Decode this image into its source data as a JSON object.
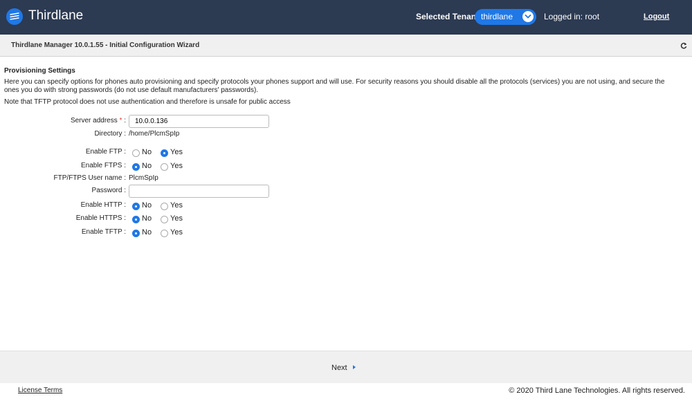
{
  "header": {
    "app_title": "Thirdlane",
    "tenant_label": "Selected Tenant :",
    "tenant_value": "thirdlane",
    "logged_in": "Logged in: root",
    "logout": "Logout"
  },
  "titlebar": {
    "title": "Thirdlane Manager 10.0.1.55 - Initial Configuration Wizard"
  },
  "provisioning": {
    "title": "Provisioning Settings",
    "description": "Here you can specify options for phones auto provisioning and specify protocols your phones support and will use. For security reasons you should disable all the protocols (services) you are not using, and secure the ones you do with strong passwords (do not use default manufacturers' passwords).",
    "note": "Note that TFTP protocol does not use authentication and therefore is unsafe for public access",
    "server_address": {
      "label": "Server address",
      "required_mark": "*",
      "colon": ":",
      "value": "10.0.0.136"
    },
    "directory": {
      "label": "Directory :",
      "value": "/home/PlcmSpIp"
    },
    "enable_ftp": {
      "label": "Enable FTP :",
      "no": "No",
      "yes": "Yes",
      "selected": "Yes"
    },
    "enable_ftps": {
      "label": "Enable FTPS :",
      "no": "No",
      "yes": "Yes",
      "selected": "No"
    },
    "ftp_user": {
      "label": "FTP/FTPS User name :",
      "value": "PlcmSpIp"
    },
    "password": {
      "label": "Password :",
      "value": ""
    },
    "enable_http": {
      "label": "Enable HTTP :",
      "no": "No",
      "yes": "Yes",
      "selected": "No"
    },
    "enable_https": {
      "label": "Enable HTTPS :",
      "no": "No",
      "yes": "Yes",
      "selected": "No"
    },
    "enable_tftp": {
      "label": "Enable TFTP :",
      "no": "No",
      "yes": "Yes",
      "selected": "No"
    }
  },
  "nav": {
    "next": "Next"
  },
  "footer": {
    "license": "License Terms",
    "copyright": "© 2020 Third Lane Technologies. All rights reserved."
  },
  "colors": {
    "header_bg": "#2c3a52",
    "accent": "#1f78e6",
    "required": "#e53935"
  }
}
